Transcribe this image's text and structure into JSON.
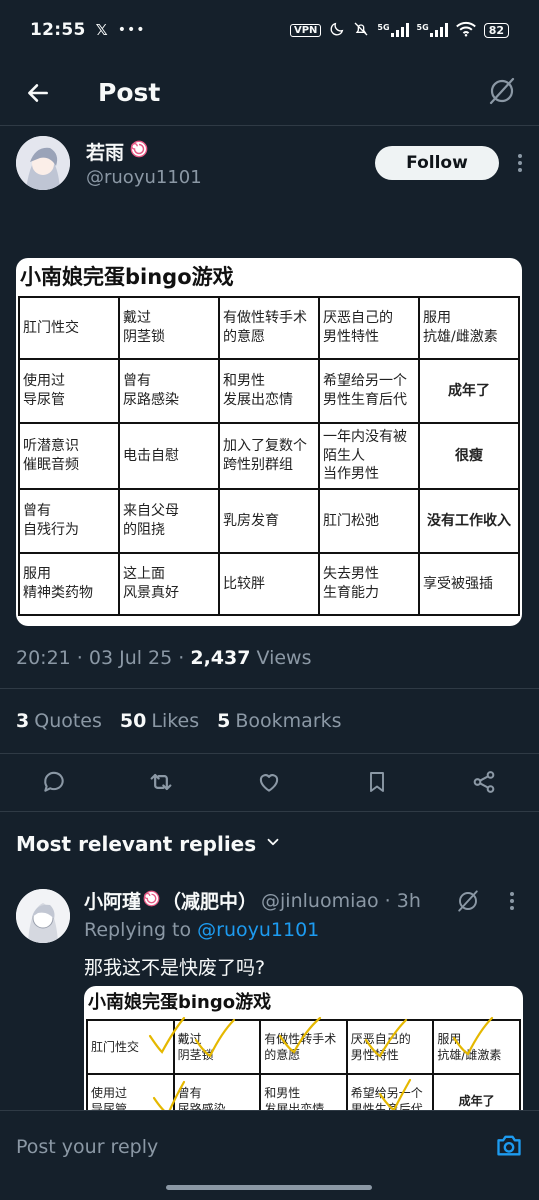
{
  "status_bar": {
    "time": "12:55",
    "left_icons": [
      "x-icon",
      "more-icon"
    ],
    "vpn": "VPN",
    "battery": "82",
    "signal_label": "5G"
  },
  "header": {
    "title": "Post"
  },
  "post": {
    "author_name": "若雨",
    "author_handle": "@ruoyu1101",
    "follow_label": "Follow",
    "image_title": "小南娘完蛋bingo游戏",
    "bingo": [
      [
        "肛门性交",
        "戴过\n阴茎锁",
        "有做性转手术\n的意愿",
        "厌恶自己的\n男性特性",
        "服用\n抗雄/雌激素"
      ],
      [
        "使用过\n导尿管",
        "曾有\n尿路感染",
        "和男性\n发展出恋情",
        "希望给另一个\n男性生育后代",
        "成年了"
      ],
      [
        "听潜意识\n催眠音频",
        "电击自慰",
        "加入了复数个\n跨性别群组",
        "一年内没有被\n陌生人\n当作男性",
        "很瘦"
      ],
      [
        "曾有\n自残行为",
        "来自父母\n的阻挠",
        "乳房发育",
        "肛门松弛",
        "没有工作收入"
      ],
      [
        "服用\n精神类药物",
        "这上面\n风景真好",
        "比较胖",
        "失去男性\n生育能力",
        "享受被强插"
      ]
    ],
    "timestamp": "20:21 · 03 Jul 25 · ",
    "views_count": "2,437",
    "views_label": " Views",
    "quotes_count": "3",
    "quotes_label": "Quotes",
    "likes_count": "50",
    "likes_label": "Likes",
    "bookmarks_count": "5",
    "bookmarks_label": "Bookmarks"
  },
  "replies": {
    "sort_label": "Most relevant replies",
    "items": [
      {
        "name": "小阿瑾",
        "name_suffix": "（减肥中）",
        "handle": "@jinluomiao · 3h",
        "replying_prefix": "Replying to ",
        "replying_handle": "@ruoyu1101",
        "text": "那我这不是快废了吗?",
        "image_title": "小南娘完蛋bingo游戏"
      }
    ]
  },
  "composer": {
    "placeholder": "Post your reply"
  },
  "colors": {
    "background": "#15202b",
    "accent": "#1d9bf0",
    "muted": "#8b98a5",
    "check": "#e5b800"
  }
}
